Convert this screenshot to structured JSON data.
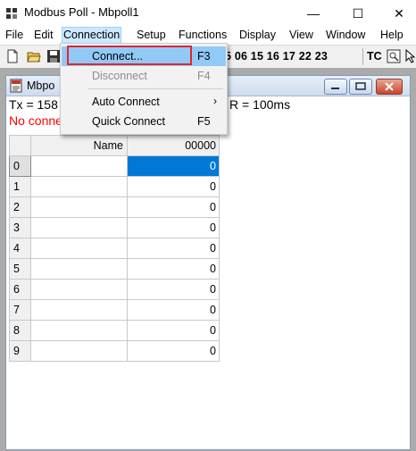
{
  "window": {
    "title": "Modbus Poll - Mbpoll1",
    "min_glyph": "—",
    "max_glyph": "☐",
    "close_glyph": "✕"
  },
  "menubar": {
    "items": [
      "File",
      "Edit",
      "Connection",
      "Setup",
      "Functions",
      "Display",
      "View",
      "Window",
      "Help"
    ]
  },
  "toolbar": {
    "icons": [
      "new-document-icon",
      "open-folder-icon",
      "save-disk-icon"
    ],
    "function_codes": "5 06 15 16 17 22 23",
    "tc_label": "TC"
  },
  "child": {
    "title": "Mbpo",
    "status_tx": "Tx = 158",
    "status_tx_tail": "R = 100ms",
    "status_error": "No conne"
  },
  "grid": {
    "name_header": "Name",
    "value_header": "00000",
    "rows": [
      {
        "index": "0",
        "name": "",
        "value": "0"
      },
      {
        "index": "1",
        "name": "",
        "value": "0"
      },
      {
        "index": "2",
        "name": "",
        "value": "0"
      },
      {
        "index": "3",
        "name": "",
        "value": "0"
      },
      {
        "index": "4",
        "name": "",
        "value": "0"
      },
      {
        "index": "5",
        "name": "",
        "value": "0"
      },
      {
        "index": "6",
        "name": "",
        "value": "0"
      },
      {
        "index": "7",
        "name": "",
        "value": "0"
      },
      {
        "index": "8",
        "name": "",
        "value": "0"
      },
      {
        "index": "9",
        "name": "",
        "value": "0"
      }
    ]
  },
  "connection_menu": {
    "connect": {
      "label": "Connect...",
      "shortcut": "F3"
    },
    "disconnect": {
      "label": "Disconnect",
      "shortcut": "F4"
    },
    "auto_connect": {
      "label": "Auto Connect",
      "arrow": "›"
    },
    "quick_connect": {
      "label": "Quick Connect",
      "shortcut": "F5"
    }
  },
  "colors": {
    "highlight": "#91c9f7",
    "annotation_red": "#e3262c",
    "selected_cell": "#0078d7",
    "error_text": "#ff0000"
  }
}
